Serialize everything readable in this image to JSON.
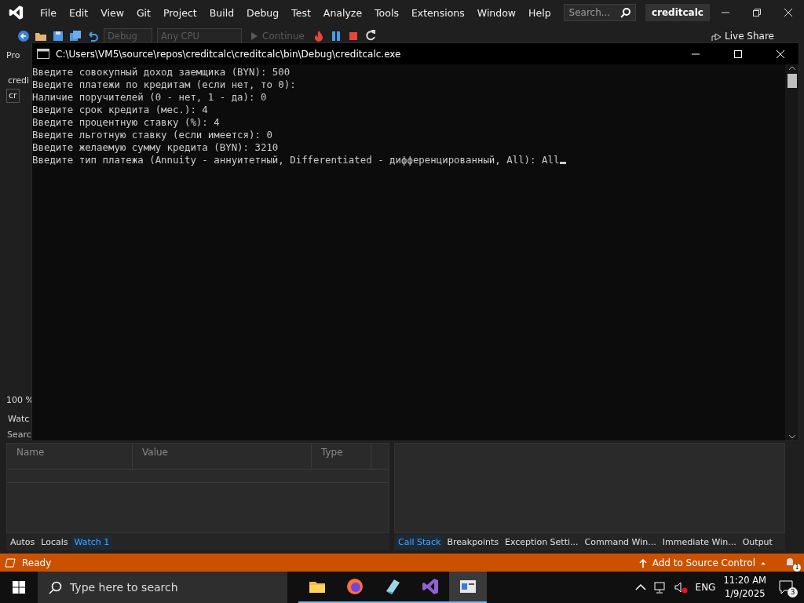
{
  "menu_bar": {
    "items": [
      "File",
      "Edit",
      "View",
      "Git",
      "Project",
      "Build",
      "Debug",
      "Test",
      "Analyze",
      "Tools",
      "Extensions",
      "Window",
      "Help"
    ],
    "search": {
      "placeholder": "Search..."
    },
    "solution_name": "creditcalc"
  },
  "toolbar": {
    "configuration": {
      "label": "Debug",
      "disabled": true
    },
    "platform": {
      "label": "Any CPU",
      "disabled": true
    },
    "continue": {
      "label": "Continue",
      "disabled": true
    },
    "live_share": "Live Share"
  },
  "left_strip": {
    "texts": [
      "Pro",
      "credi",
      "cr"
    ],
    "zoom": "100 %",
    "watch_title": "Watc",
    "watch_search": "Searc"
  },
  "watch_panel": {
    "columns": [
      "Name",
      "Value",
      "Type"
    ],
    "tabs": [
      {
        "label": "Autos",
        "selected": false
      },
      {
        "label": "Locals",
        "selected": false
      },
      {
        "label": "Watch 1",
        "selected": true
      }
    ]
  },
  "right_panel": {
    "tabs": [
      {
        "label": "Call Stack",
        "selected": true
      },
      {
        "label": "Breakpoints",
        "selected": false
      },
      {
        "label": "Exception Setti...",
        "selected": false
      },
      {
        "label": "Command Win...",
        "selected": false
      },
      {
        "label": "Immediate Win...",
        "selected": false
      },
      {
        "label": "Output",
        "selected": false
      }
    ]
  },
  "console": {
    "title": "C:\\Users\\VM5\\source\\repos\\creditcalc\\creditcalc\\bin\\Debug\\creditcalc.exe",
    "cursor_visible": true,
    "lines": [
      "Введите совокупный доход заемщика (BYN): 500",
      "Введите платежи по кредитам (если нет, то 0):",
      "Наличие поручителей (0 - нет, 1 - да): 0",
      "Введите срок кредита (мес.): 4",
      "Введите процентную ставку (%): 4",
      "Введите льготную ставку (если имеется): 0",
      "Введите желаемую сумму кредита (BYN): 3210",
      "Введите тип платежа (Annuity - аннуитетный, Differentiated - дифференцированный, All): All"
    ]
  },
  "status_bar": {
    "text": "Ready",
    "source_control": "Add to Source Control",
    "notifications": "1"
  },
  "taskbar": {
    "search": {
      "placeholder": "Type here to search"
    },
    "apps": [
      {
        "kind": "folder",
        "selected": false
      },
      {
        "kind": "firefox",
        "selected": false
      },
      {
        "kind": "notepad",
        "selected": false
      },
      {
        "kind": "visualstudio",
        "selected": false
      },
      {
        "kind": "console",
        "selected": true
      }
    ],
    "language": "ENG",
    "time": "11:20 AM",
    "date": "1/9/2025",
    "notifications": "3"
  }
}
